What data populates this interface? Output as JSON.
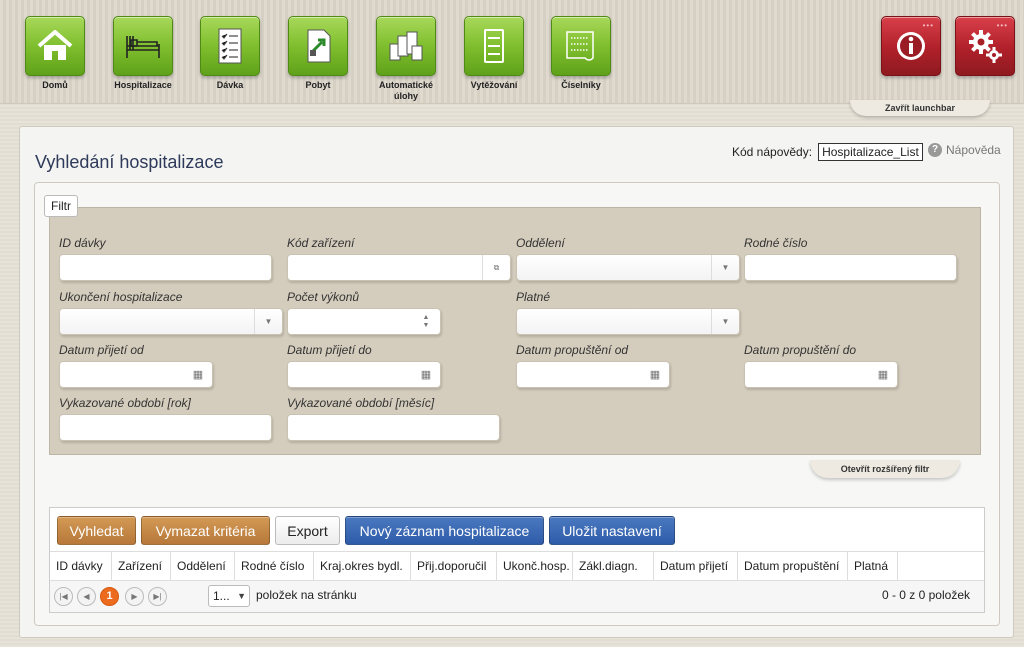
{
  "launchbar": {
    "items": [
      {
        "label": "Domů",
        "icon": "home-icon"
      },
      {
        "label": "Hospitalizace",
        "icon": "hospital-bed-icon"
      },
      {
        "label": "Dávka",
        "icon": "batch-document-icon"
      },
      {
        "label": "Pobyt",
        "icon": "stay-document-icon"
      },
      {
        "label": "Automatické úlohy",
        "icon": "automatic-tasks-icon"
      },
      {
        "label": "Vytěžování",
        "icon": "extraction-icon"
      },
      {
        "label": "Číselníky",
        "icon": "codebook-icon"
      }
    ],
    "right_items": [
      {
        "icon": "info-icon",
        "dots": "•••"
      },
      {
        "icon": "settings-gears-icon",
        "dots": "•••"
      }
    ],
    "close_label": "Zavřít launchbar",
    "accent_color": "#7fbf2e",
    "right_color": "#b0202a"
  },
  "page": {
    "title": "Vyhledání hospitalizace",
    "help_code_label": "Kód nápovědy:",
    "help_code_value": "Hospitalizace_List",
    "help_link": "Nápověda"
  },
  "filter": {
    "legend": "Filtr",
    "fields": {
      "id_davky": "ID dávky",
      "kod_zarizeni": "Kód zařízení",
      "oddeleni": "Oddělení",
      "rodne_cislo": "Rodné číslo",
      "ukonceni": "Ukončení hospitalizace",
      "pocet_vykonu": "Počet výkonů",
      "platne": "Platné",
      "datum_prijeti_od": "Datum přijetí od",
      "datum_prijeti_do": "Datum přijetí do",
      "datum_propusteni_od": "Datum propuštění od",
      "datum_propusteni_do": "Datum propuštění do",
      "obdobi_rok": "Vykazované období [rok]",
      "obdobi_mesic": "Vykazované období [měsíc]"
    },
    "open_extended": "Otevřít rozšířený filtr"
  },
  "toolbar": {
    "search": "Vyhledat",
    "clear": "Vymazat kritéria",
    "export": "Export",
    "new_record": "Nový záznam hospitalizace",
    "save_settings": "Uložit nastavení"
  },
  "table": {
    "columns": [
      "ID dávky",
      "Zařízení",
      "Oddělení",
      "Rodné číslo",
      "Kraj.okres bydl.",
      "Přij.doporučil",
      "Ukonč.hosp.",
      "Zákl.diagn.",
      "Datum přijetí",
      "Datum propuštění",
      "Platná"
    ]
  },
  "pager": {
    "current_page": "1",
    "page_size": "1...",
    "per_page_label": "položek na stránku",
    "info": "0 - 0 z 0 položek"
  }
}
